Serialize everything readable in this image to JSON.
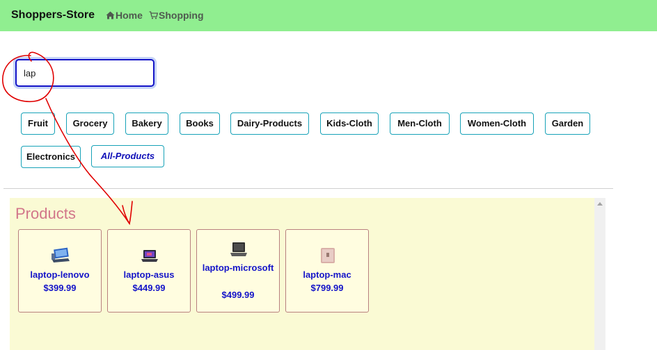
{
  "navbar": {
    "brand": "Shoppers-Store",
    "links": [
      {
        "label": "Home",
        "icon": "home-icon"
      },
      {
        "label": "Shopping",
        "icon": "cart-icon"
      }
    ],
    "background": "#90ee90"
  },
  "search": {
    "value": "lap",
    "placeholder": ""
  },
  "categories": [
    "Fruit",
    "Grocery",
    "Bakery",
    "Books",
    "Dairy-Products",
    "Kids-Cloth",
    "Men-Cloth",
    "Women-Cloth",
    "Garden",
    "Electronics",
    "All-Products"
  ],
  "active_category": "All-Products",
  "products_section": {
    "title": "Products",
    "items": [
      {
        "name": "laptop-lenovo",
        "price": "$399.99",
        "icon": "laptop-tablet-icon"
      },
      {
        "name": "laptop-asus",
        "price": "$449.99",
        "icon": "laptop-icon"
      },
      {
        "name": "laptop-microsoft",
        "price": "$499.99",
        "icon": "laptop-icon"
      },
      {
        "name": "laptop-mac",
        "price": "$799.99",
        "icon": "laptop-icon"
      }
    ]
  },
  "colors": {
    "accent": "#1414c8",
    "category_border": "#17a2b8",
    "panel_bg": "#fafad4",
    "title": "#d2768a",
    "annotation": "#e00000"
  }
}
